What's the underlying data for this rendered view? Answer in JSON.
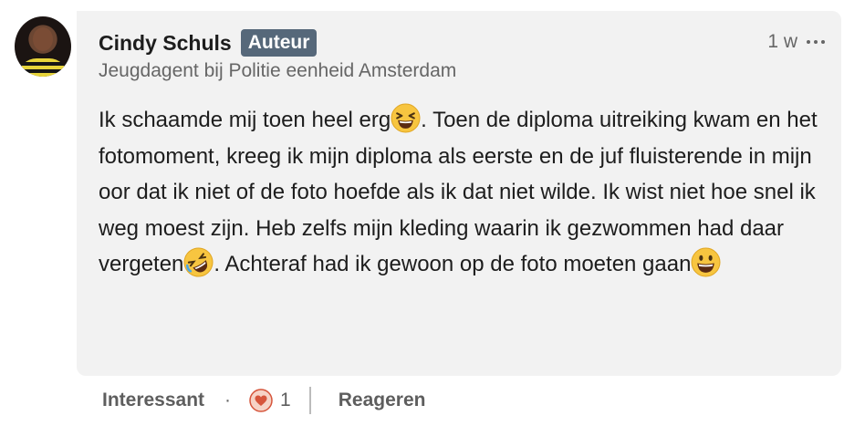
{
  "comment": {
    "author_name": "Cindy Schuls",
    "author_badge": "Auteur",
    "author_headline": "Jeugdagent bij Politie eenheid Amsterdam",
    "timestamp": "1 w",
    "more_icon": "more-horizontal-icon",
    "text_parts": {
      "p1": "Ik schaamde mij toen heel erg",
      "p2": ". Toen de diploma uitreiking kwam en het fotomoment, kreeg ik mijn diploma als eerste en de juf fluisterende in mijn oor dat ik niet of de foto hoefde als ik dat niet wilde. Ik wist niet hoe snel ik weg moest zijn. Heb zelfs mijn kleding waarin ik gezwommen had daar vergeten",
      "p3": ". Achteraf had ik gewoon op de foto moeten gaan"
    },
    "emojis": [
      "grinning-squinting-face",
      "rolling-on-the-floor-laughing",
      "grinning-face"
    ]
  },
  "actions": {
    "like_label": "Interessant",
    "separator_dot": "·",
    "reaction_icon": "heart-reaction-icon",
    "reaction_count": "1",
    "reply_label": "Reageren"
  },
  "colors": {
    "bubble_bg": "#f2f2f2",
    "badge_bg": "#56687a",
    "secondary_text": "#666666",
    "heart": "#d6553b"
  }
}
